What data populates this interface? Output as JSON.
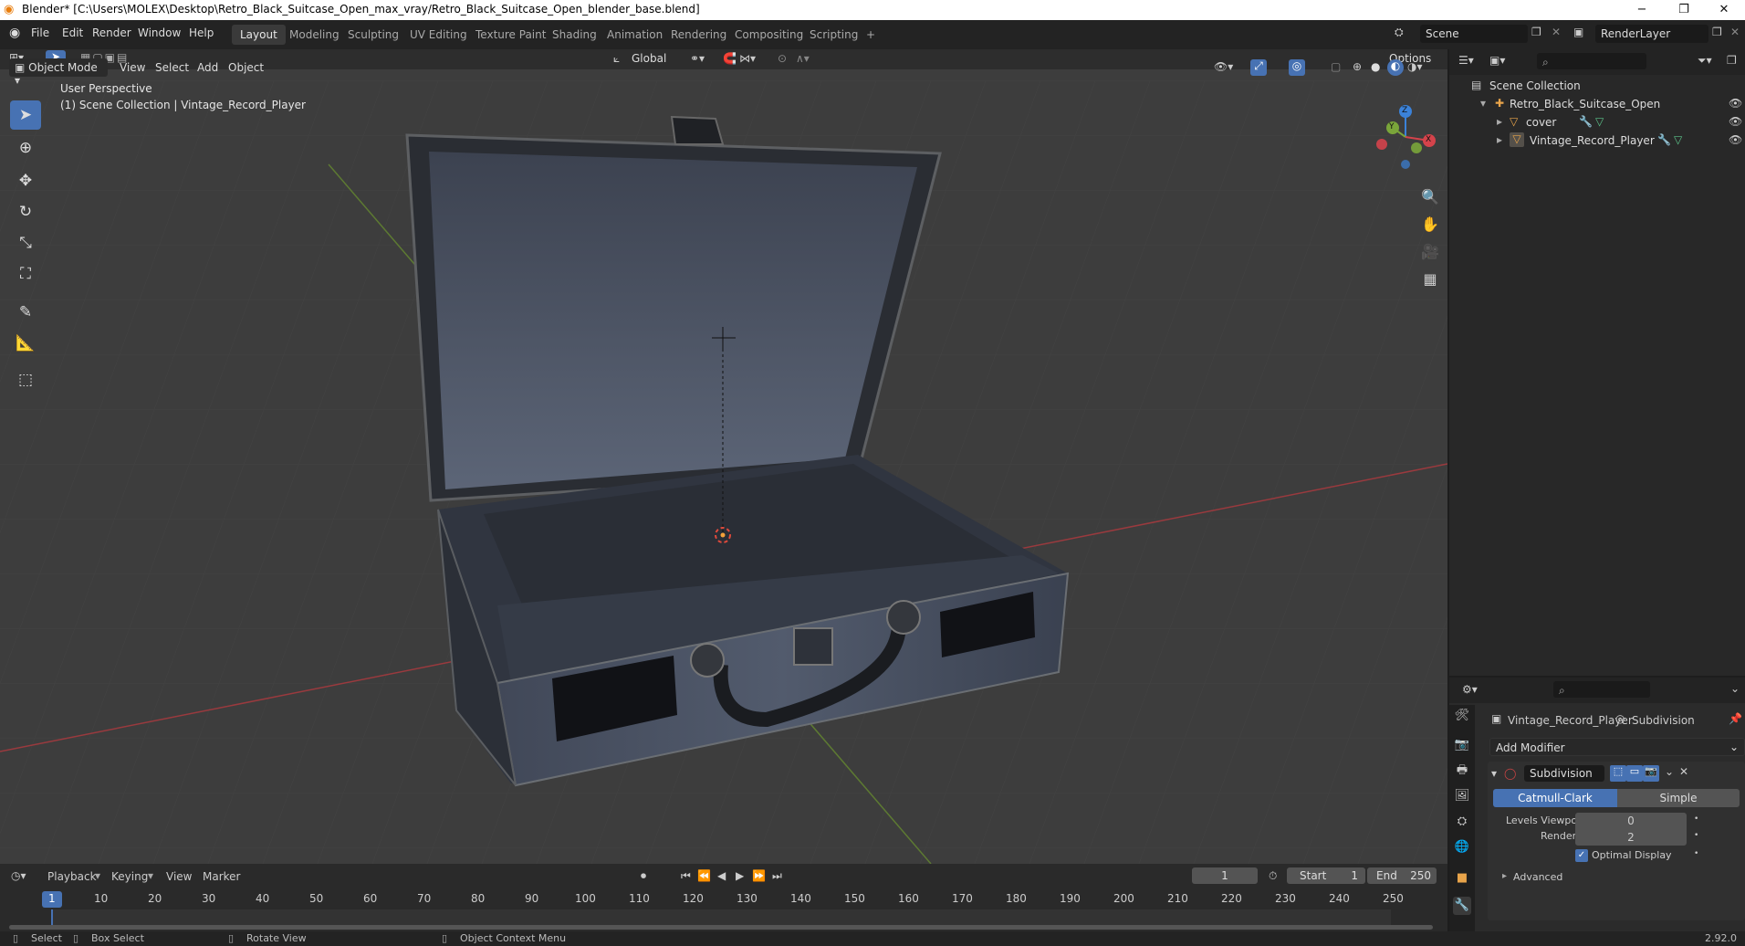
{
  "window": {
    "title": "Blender* [C:\\Users\\MOLEX\\Desktop\\Retro_Black_Suitcase_Open_max_vray/Retro_Black_Suitcase_Open_blender_base.blend]",
    "minimize": "−",
    "maximize": "❐",
    "close": "✕"
  },
  "menu": [
    "File",
    "Edit",
    "Render",
    "Window",
    "Help"
  ],
  "workspaces": [
    "Layout",
    "Modeling",
    "Sculpting",
    "UV Editing",
    "Texture Paint",
    "Shading",
    "Animation",
    "Rendering",
    "Compositing",
    "Scripting",
    "+"
  ],
  "scene": {
    "name": "Scene",
    "render_layer": "RenderLayer"
  },
  "view3d": {
    "mode": "Object Mode",
    "menus": [
      "View",
      "Select",
      "Add",
      "Object"
    ],
    "orientation": "Global",
    "options": "Options",
    "perspective": "User Perspective",
    "collection_info": "(1) Scene Collection | Vintage_Record_Player",
    "gizmo": {
      "x": "X",
      "y": "Y",
      "z": "Z"
    }
  },
  "outliner": {
    "root": "Scene Collection",
    "items": [
      {
        "name": "Retro_Black_Suitcase_Open",
        "level": 1
      },
      {
        "name": "cover",
        "level": 2
      },
      {
        "name": "Vintage_Record_Player",
        "level": 2
      }
    ]
  },
  "properties": {
    "object": "Vintage_Record_Player",
    "modifier_tab": "Subdivision",
    "add_modifier": "Add Modifier",
    "modifier_name": "Subdivision",
    "type_options": [
      "Catmull-Clark",
      "Simple"
    ],
    "levels_viewport_label": "Levels Viewport",
    "levels_viewport": "0",
    "render_label": "Render",
    "render": "2",
    "optimal_display": "Optimal Display",
    "advanced": "Advanced"
  },
  "timeline": {
    "menus": [
      "Playback",
      "Keying",
      "View",
      "Marker"
    ],
    "current_frame": "1",
    "start_label": "Start",
    "start": "1",
    "end_label": "End",
    "end": "250",
    "ticks": [
      "1",
      "10",
      "20",
      "30",
      "40",
      "50",
      "60",
      "70",
      "80",
      "90",
      "100",
      "110",
      "120",
      "130",
      "140",
      "150",
      "160",
      "170",
      "180",
      "190",
      "200",
      "210",
      "220",
      "230",
      "240",
      "250"
    ]
  },
  "statusbar": {
    "select": "Select",
    "box_select": "Box Select",
    "rotate_view": "Rotate View",
    "context_menu": "Object Context Menu",
    "version": "2.92.0"
  },
  "colors": {
    "accent": "#4772b3",
    "viewport_bg": "#3d3d3d",
    "x_axis": "#d4434b",
    "y_axis": "#7aa53a",
    "z_axis": "#3b82d9"
  }
}
